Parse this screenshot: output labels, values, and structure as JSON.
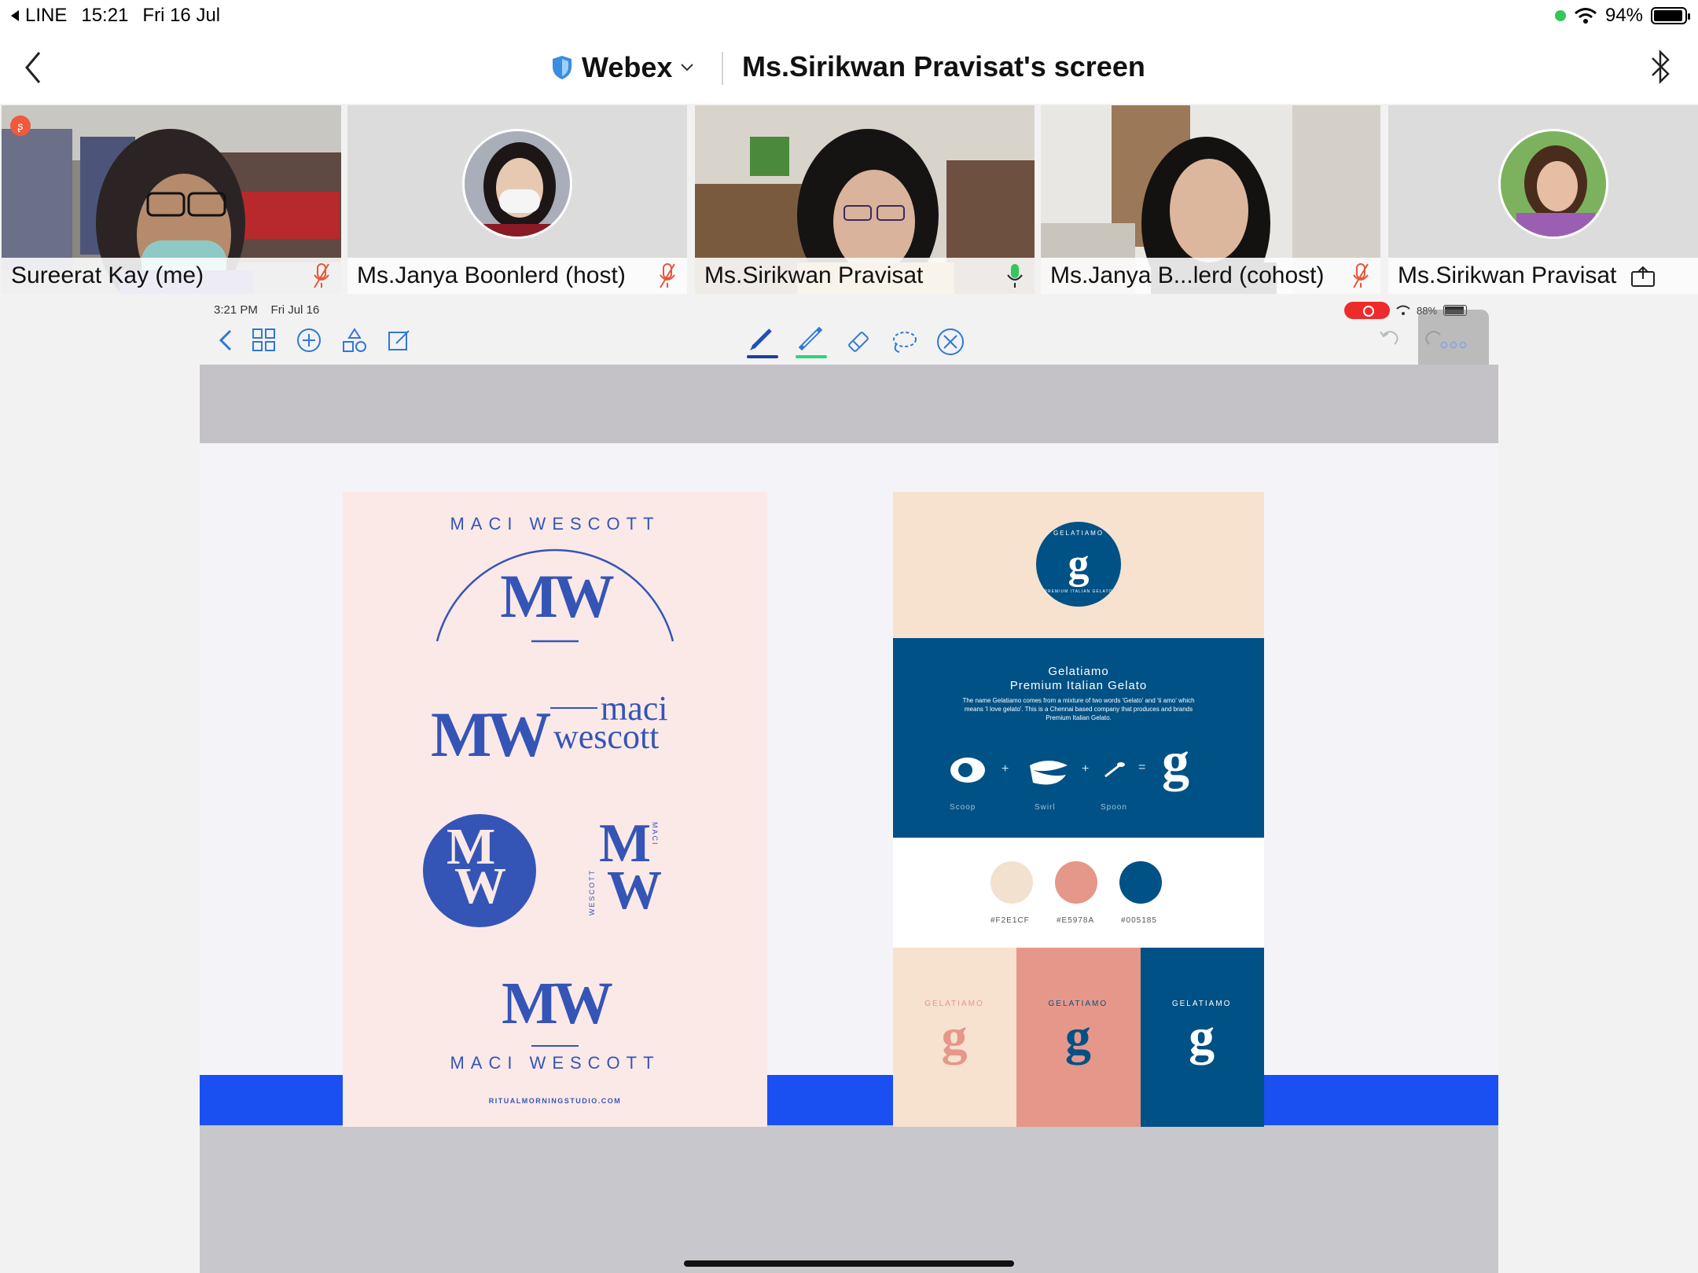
{
  "status_bar": {
    "back_app": "LINE",
    "time": "15:21",
    "date": "Fri 16 Jul",
    "battery": "94%"
  },
  "title_bar": {
    "app_name": "Webex",
    "screen_title": "Ms.Sirikwan Pravisat's screen"
  },
  "participants": [
    {
      "name": "Sureerat Kay (me)",
      "muted": true
    },
    {
      "name": "Ms.Janya Boonlerd (host)",
      "muted": true
    },
    {
      "name": "Ms.Sirikwan Pravisat",
      "muted": false
    },
    {
      "name": "Ms.Janya B...lerd (cohost)",
      "muted": true
    },
    {
      "name": "Ms.Sirikwan Pravisat",
      "sharing": true
    }
  ],
  "shared_screen": {
    "ipad_time": "3:21 PM",
    "ipad_date": "Fri Jul 16",
    "ipad_battery": "88%",
    "mw_board": {
      "arc_text": "MACI WESCOTT",
      "monogram": "MW",
      "wordmark_top": "maci",
      "wordmark_bottom": "wescott",
      "side_vertical_top": "MACI",
      "side_vertical_left": "WESCOTT",
      "mono_m": "M",
      "mono_w": "W",
      "footer_name": "MACI WESCOTT",
      "website": "RITUALMORNINGSTUDIO.COM"
    },
    "gelato_board": {
      "badge_arc": "GELATIAMO",
      "badge_arc_bottom": "PREMIUM ITALIAN GELATO",
      "badge_letter": "g",
      "brand": "Gelatiamo",
      "tagline": "Premium Italian Gelato",
      "description": "The name Gelatiamo comes from a mixture of two words 'Gelato' and 'ti amo' which means 'I love gelato'. This is a Chennai based company that produces and brands Premium Italian Gelato.",
      "plus": "+",
      "equals": "=",
      "formula": [
        {
          "label": "Scoop"
        },
        {
          "label": "Swirl"
        },
        {
          "label": "Spoon"
        }
      ],
      "palette": [
        {
          "hex": "#F2E1CF",
          "color": "#f2e1cf"
        },
        {
          "hex": "#E5978A",
          "color": "#e5978a"
        },
        {
          "hex": "#005185",
          "color": "#005185"
        }
      ]
    }
  }
}
